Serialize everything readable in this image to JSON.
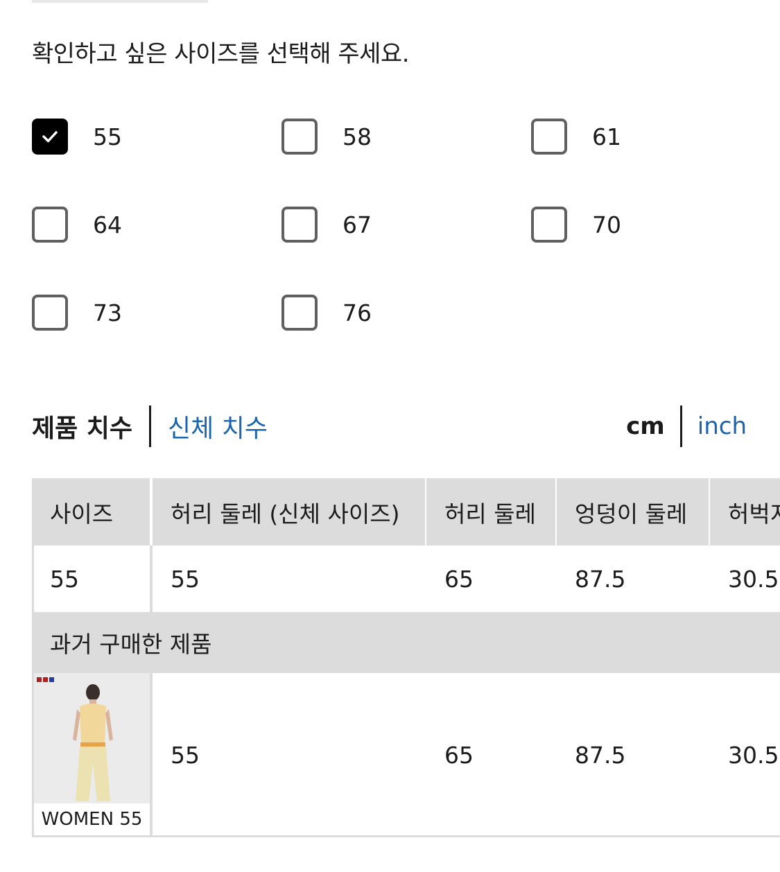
{
  "prompt": "확인하고 싶은 사이즈를 선택해 주세요.",
  "sizes": [
    {
      "label": "55",
      "checked": true
    },
    {
      "label": "58",
      "checked": false
    },
    {
      "label": "61",
      "checked": false
    },
    {
      "label": "64",
      "checked": false
    },
    {
      "label": "67",
      "checked": false
    },
    {
      "label": "70",
      "checked": false
    },
    {
      "label": "73",
      "checked": false
    },
    {
      "label": "76",
      "checked": false
    }
  ],
  "tabs": {
    "product": "제품 치수",
    "body": "신체 치수"
  },
  "units": {
    "cm": "cm",
    "inch": "inch"
  },
  "table": {
    "headers": [
      "사이즈",
      "허리 둘레 (신체 사이즈)",
      "허리 둘레",
      "엉덩이 둘레",
      "허벅지"
    ],
    "row": [
      "55",
      "55",
      "65",
      "87.5",
      "30.5"
    ],
    "section_label": "과거 구매한 제품",
    "purchased": {
      "thumb_label": "WOMEN 55",
      "values": [
        "55",
        "65",
        "87.5",
        "30.5"
      ]
    }
  },
  "colors": {
    "link": "#1a64b0",
    "header_bg": "#dcdcdc",
    "checkbox_checked": "#000000",
    "checkbox_border": "#606060"
  }
}
